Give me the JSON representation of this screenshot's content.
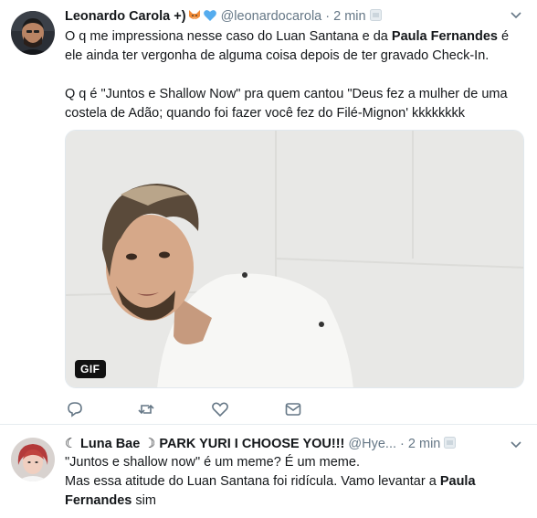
{
  "tweets": [
    {
      "display_name": "Leonardo Carola +)",
      "handle": "@leonardocarola",
      "separator": "·",
      "time": "2 min",
      "text_line1_a": "O q me impressiona nesse caso do Luan Santana e da ",
      "text_line1_bold": "Paula Fernandes",
      "text_line1_b": " é ele ainda ter vergonha de alguma coisa depois de ter gravado Check-In.",
      "text_line2": "Q q é \"Juntos e Shallow Now\" pra quem cantou \"Deus fez a mulher de uma costela de Adão; quando foi fazer você fez do Filé-Mignon' kkkkkkkk",
      "media_badge": "GIF",
      "icons": [
        "reply-icon",
        "retweet-icon",
        "like-icon",
        "direct-message-icon"
      ]
    },
    {
      "display_name": "☾ Luna Bae ☽ PARK YURI I CHOOSE YOU!!!",
      "handle": "@Hye...",
      "separator": "·",
      "time": "2 min",
      "text_line1": "\"Juntos e shallow now\" é um meme? É um meme.",
      "text_line2_a": "Mas essa atitude do Luan Santana foi ridícula. Vamo levantar a ",
      "text_line2_bold": "Paula Fernandes",
      "text_line2_b": " sim"
    }
  ],
  "colors": {
    "text": "#14171a",
    "secondary": "#657786",
    "border": "#e6ecf0",
    "heart": "#55acee"
  }
}
